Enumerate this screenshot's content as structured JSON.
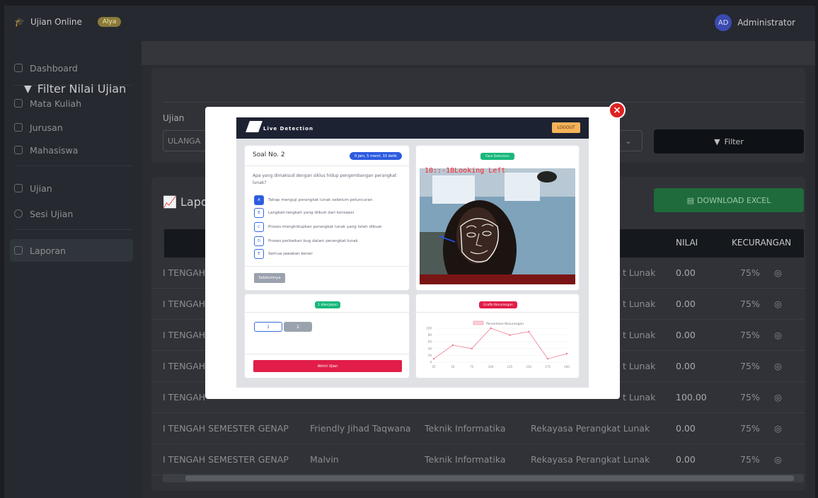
{
  "header": {
    "brand": "Ujian Online",
    "badge": "Alya",
    "user_initials": "AD",
    "user_name": "Administrator"
  },
  "sidebar": {
    "items": [
      {
        "label": "Dashboard",
        "icon": "dashboard-icon"
      },
      {
        "label": "Mata Kuliah",
        "icon": "book-icon"
      },
      {
        "label": "Jurusan",
        "icon": "folder-icon"
      },
      {
        "label": "Mahasiswa",
        "icon": "users-icon"
      },
      {
        "label": "Ujian",
        "icon": "edit-icon"
      },
      {
        "label": "Sesi Ujian",
        "icon": "clock-icon"
      },
      {
        "label": "Laporan",
        "icon": "chart-line-icon"
      }
    ],
    "active": "Laporan"
  },
  "filter": {
    "title": "Filter Nilai Ujian",
    "ujian_label": "Ujian",
    "ujian_value": "ULANGA",
    "button": "Filter"
  },
  "laporan": {
    "title": "Lapo",
    "download_button": "DOWNLOAD EXCEL",
    "columns": [
      "NILAI",
      "KECURANGAN"
    ],
    "rows": [
      {
        "ujian": "I TENGAH",
        "nama": "",
        "jurusan": "",
        "matkul": "t Lunak",
        "nilai": "0.00",
        "kecurangan": "75%"
      },
      {
        "ujian": "I TENGAH",
        "nama": "",
        "jurusan": "",
        "matkul": "t Lunak",
        "nilai": "0.00",
        "kecurangan": "75%"
      },
      {
        "ujian": "I TENGAH",
        "nama": "",
        "jurusan": "",
        "matkul": "t Lunak",
        "nilai": "0.00",
        "kecurangan": "75%"
      },
      {
        "ujian": "I TENGAH",
        "nama": "",
        "jurusan": "",
        "matkul": "t Lunak",
        "nilai": "0.00",
        "kecurangan": "75%"
      },
      {
        "ujian": "I TENGAH",
        "nama": "",
        "jurusan": "",
        "matkul": "t Lunak",
        "nilai": "100.00",
        "kecurangan": "75%"
      },
      {
        "ujian": "I TENGAH SEMESTER GENAP",
        "nama": "Friendly Jihad Taqwana",
        "jurusan": "Teknik Informatika",
        "matkul": "Rekayasa Perangkat Lunak",
        "nilai": "0.00",
        "kecurangan": "75%"
      },
      {
        "ujian": "I TENGAH SEMESTER GENAP",
        "nama": "Malvin",
        "jurusan": "Teknik Informatika",
        "matkul": "Rekayasa Perangkat Lunak",
        "nilai": "0.00",
        "kecurangan": "75%"
      }
    ]
  },
  "modal": {
    "close": "×",
    "app_title": "Live Detection",
    "logout": "LOGOUT",
    "soal_title": "Soal No. 2",
    "timer": "0 jam, 5 menit, 33 detik",
    "question": "Apa yang dimaksud dengan siklus hidup pengembangan perangkat lunak?",
    "options": [
      {
        "key": "A",
        "text": "Tahap menguji perangkat lunak sebelum peluncuran",
        "selected": true
      },
      {
        "key": "B",
        "text": "Langkah-langkah yang diikuti dari konsepsi",
        "selected": false
      },
      {
        "key": "C",
        "text": "Proses menghidupkan perangkat lunak yang telah dibuat",
        "selected": false
      },
      {
        "key": "D",
        "text": "Proses perbaikan bug dalam perangkat lunak",
        "selected": false
      },
      {
        "key": "E",
        "text": "Semua jawaban benar",
        "selected": false
      }
    ],
    "prev_button": "Sebelumnya",
    "face_detection_label": "Face Detection",
    "detection_text": "10::-18Looking Left",
    "answered_label": "1 dikerjakan",
    "question_numbers": [
      "1",
      "2"
    ],
    "end_button": "Akhiri Ujian",
    "chart_label": "Grafik Kecurangan"
  },
  "chart_data": {
    "type": "line",
    "title": "",
    "series": [
      {
        "name": "Persentase Kecurangan",
        "values": [
          10,
          50,
          40,
          100,
          80,
          90,
          10,
          25
        ]
      }
    ],
    "x": [
      25,
      50,
      75,
      100,
      125,
      150,
      175,
      200
    ],
    "yticks": [
      0,
      20,
      40,
      60,
      80,
      100
    ],
    "ylim": [
      0,
      100
    ],
    "xlabel": "",
    "ylabel": "",
    "color": "#f07a90",
    "legend": "top-center",
    "grid": true
  }
}
